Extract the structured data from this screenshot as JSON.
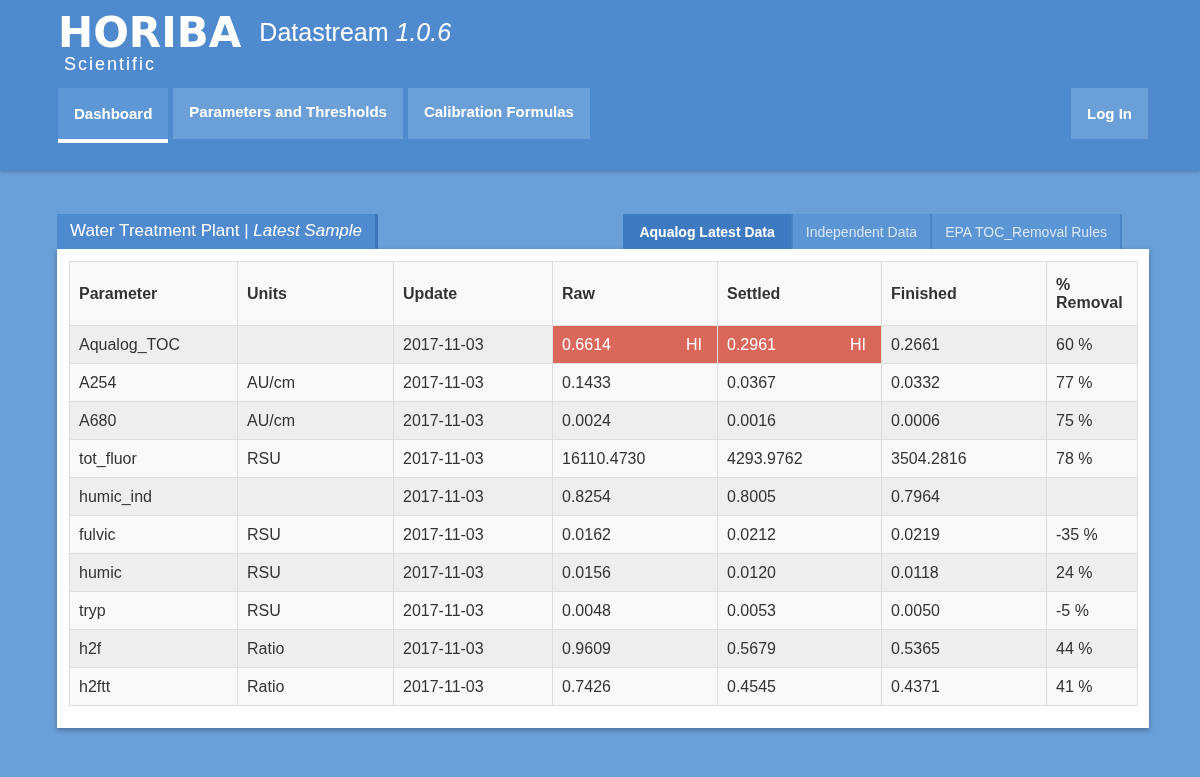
{
  "header": {
    "logo": "HORIBA",
    "logo_sub": "Scientific",
    "app_name": "Datastream",
    "version": "1.0.6",
    "nav": [
      {
        "label": "Dashboard",
        "selected": true
      },
      {
        "label": "Parameters and Thresholds",
        "selected": false
      },
      {
        "label": "Calibration Formulas",
        "selected": false
      }
    ],
    "login": "Log In"
  },
  "panel": {
    "title": "Water Treatment Plant | *Latest Sample*",
    "tabs": [
      {
        "label": "Aqualog Latest Data",
        "selected": true
      },
      {
        "label": "Independent Data",
        "selected": false
      },
      {
        "label": "EPA TOC_Removal Rules",
        "selected": false
      }
    ],
    "table": {
      "columns": [
        "Parameter",
        "Units",
        "Update",
        "Raw",
        "Settled",
        "Finished",
        "% Removal"
      ],
      "rows": [
        {
          "parameter": "Aqualog_TOC",
          "update": "2017-11-03",
          "raw": {
            "value": "0.6614",
            "alert": true,
            "flag": "HI"
          },
          "settled": {
            "value": "0.2961",
            "alert": true,
            "flag": "HI"
          },
          "finished": "0.2661",
          "removal": "60 %"
        },
        {
          "parameter": "A254",
          "units": "AU/cm",
          "update": "2017-11-03",
          "raw": {
            "value": "0.1433",
            "alert": false
          },
          "settled": {
            "value": "0.0367",
            "alert": false
          },
          "finished": "0.0332",
          "removal": "77 %"
        },
        {
          "parameter": "A680",
          "units": "AU/cm",
          "update": "2017-11-03",
          "raw": {
            "value": "0.0024",
            "alert": false
          },
          "settled": {
            "value": "0.0016",
            "alert": false
          },
          "finished": "0.0006",
          "removal": "75 %"
        },
        {
          "parameter": "tot_fluor",
          "units": "RSU",
          "update": "2017-11-03",
          "raw": {
            "value": "16110.4730",
            "alert": false
          },
          "settled": {
            "value": "4293.9762",
            "alert": false
          },
          "finished": "3504.2816",
          "removal": "78 %"
        },
        {
          "parameter": "humic_ind",
          "update": "2017-11-03",
          "raw": {
            "value": "0.8254",
            "alert": false
          },
          "settled": {
            "value": "0.8005",
            "alert": false
          },
          "finished": "0.7964"
        },
        {
          "parameter": "fulvic",
          "units": "RSU",
          "update": "2017-11-03",
          "raw": {
            "value": "0.0162",
            "alert": false
          },
          "settled": {
            "value": "0.0212",
            "alert": false
          },
          "finished": "0.0219",
          "removal": "-35 %"
        },
        {
          "parameter": "humic",
          "units": "RSU",
          "update": "2017-11-03",
          "raw": {
            "value": "0.0156",
            "alert": false
          },
          "settled": {
            "value": "0.0120",
            "alert": false
          },
          "finished": "0.0118",
          "removal": "24 %"
        },
        {
          "parameter": "tryp",
          "units": "RSU",
          "update": "2017-11-03",
          "raw": {
            "value": "0.0048",
            "alert": false
          },
          "settled": {
            "value": "0.0053",
            "alert": false
          },
          "finished": "0.0050",
          "removal": "-5 %"
        },
        {
          "parameter": "h2f",
          "units": "Ratio",
          "update": "2017-11-03",
          "raw": {
            "value": "0.9609",
            "alert": false
          },
          "settled": {
            "value": "0.5679",
            "alert": false
          },
          "finished": "0.5365",
          "removal": "44 %"
        },
        {
          "parameter": "h2ftt",
          "units": "Ratio",
          "update": "2017-11-03",
          "raw": {
            "value": "0.7426",
            "alert": false
          },
          "settled": {
            "value": "0.4545",
            "alert": false
          },
          "finished": "0.4371",
          "removal": "41 %"
        }
      ]
    }
  }
}
